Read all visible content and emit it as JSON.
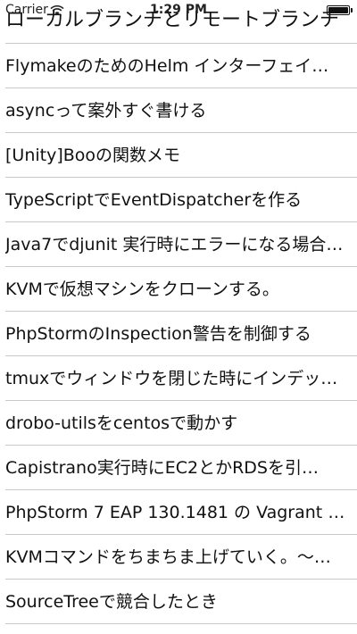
{
  "status_bar": {
    "carrier": "Carrier",
    "time": "1:29 PM",
    "battery_level": 1.0
  },
  "articles": [
    {
      "title": "ローカルブランチとリモートブランチ"
    },
    {
      "title": "FlymakeのためのHelm インターフェイ…"
    },
    {
      "title": "asyncって案外すぐ書ける"
    },
    {
      "title": "[Unity]Booの関数メモ"
    },
    {
      "title": "TypeScriptでEventDispatcherを作る"
    },
    {
      "title": "Java7でdjunit 実行時にエラーになる場合…"
    },
    {
      "title": "KVMで仮想マシンをクローンする。"
    },
    {
      "title": "PhpStormのInspection警告を制御する"
    },
    {
      "title": "tmuxでウィンドウを閉じた時にインデッ…"
    },
    {
      "title": "drobo-utilsをcentosで動かす"
    },
    {
      "title": "Capistrano実行時にEC2とかRDSを引…"
    },
    {
      "title": "PhpStorm 7 EAP 130.1481 の Vagrant 対…"
    },
    {
      "title": "KVMコマンドをちまちま上げていく。～…"
    },
    {
      "title": "SourceTreeで競合したとき"
    }
  ]
}
